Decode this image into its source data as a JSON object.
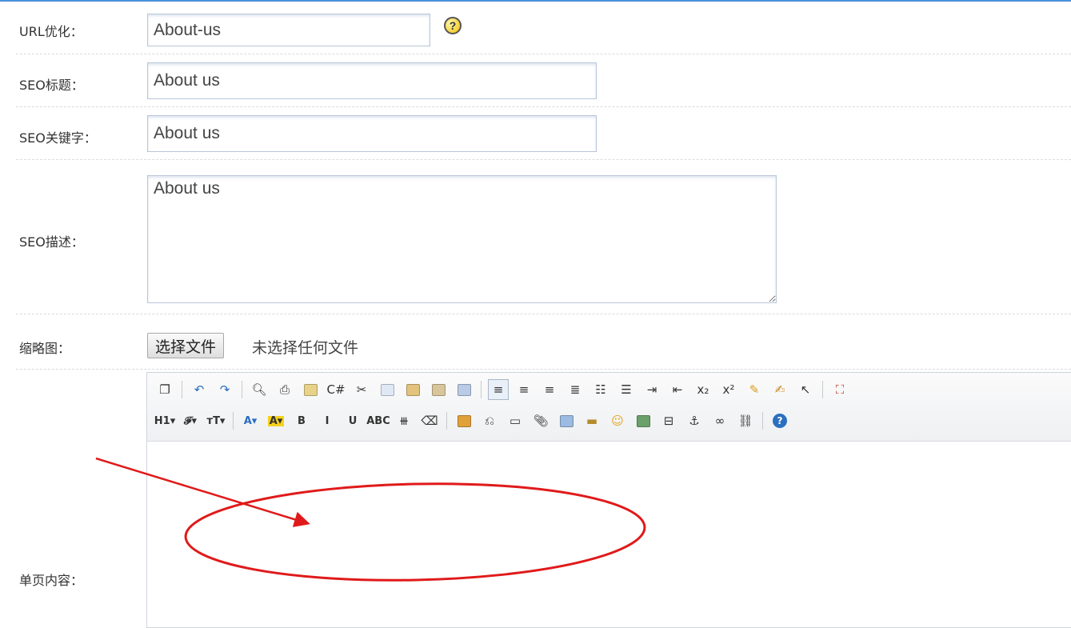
{
  "form": {
    "url": {
      "label": "URL优化：",
      "value": "About-us"
    },
    "seo_title": {
      "label": "SEO标题：",
      "value": "About us"
    },
    "seo_keywords": {
      "label": "SEO关键字：",
      "value": "About us"
    },
    "seo_desc": {
      "label": "SEO描述：",
      "value": "About us"
    },
    "thumbnail": {
      "label": "缩略图：",
      "button": "选择文件",
      "status": "未选择任何文件"
    },
    "content": {
      "label": "单页内容："
    }
  },
  "help": {
    "glyph": "?",
    "icon": "question-mark-icon"
  },
  "toolbar": {
    "row1": [
      {
        "name": "source-icon",
        "glyph": "❐"
      },
      {
        "sep": true
      },
      {
        "name": "undo-icon",
        "glyph": "↶",
        "color": "#2b6fc0"
      },
      {
        "name": "redo-icon",
        "glyph": "↷",
        "color": "#2b6fc0"
      },
      {
        "sep": true
      },
      {
        "name": "preview-icon",
        "glyph": "🔍︎"
      },
      {
        "name": "print-icon",
        "glyph": "⎙"
      },
      {
        "name": "template-icon",
        "box": "#e8d28a"
      },
      {
        "name": "code-icon",
        "glyph": "C#"
      },
      {
        "name": "cut-icon",
        "glyph": "✂"
      },
      {
        "name": "copy-icon",
        "box": "#dfe9f6"
      },
      {
        "name": "paste-icon",
        "box": "#e2c27c"
      },
      {
        "name": "paste-text-icon",
        "box": "#d8c69a"
      },
      {
        "name": "paste-word-icon",
        "box": "#b9cbe6"
      },
      {
        "sep": true
      },
      {
        "name": "align-left-icon",
        "glyph": "≡",
        "active": true
      },
      {
        "name": "align-center-icon",
        "glyph": "≡"
      },
      {
        "name": "align-right-icon",
        "glyph": "≡"
      },
      {
        "name": "justify-icon",
        "glyph": "≣"
      },
      {
        "name": "ordered-list-icon",
        "glyph": "☷"
      },
      {
        "name": "unordered-list-icon",
        "glyph": "☰"
      },
      {
        "name": "indent-icon",
        "glyph": "⇥"
      },
      {
        "name": "outdent-icon",
        "glyph": "⇤"
      },
      {
        "name": "subscript-icon",
        "glyph": "x₂"
      },
      {
        "name": "superscript-icon",
        "glyph": "x²"
      },
      {
        "name": "clear-format-icon",
        "glyph": "✎",
        "color": "#d89a1c"
      },
      {
        "name": "select-all-icon",
        "glyph": "✍",
        "color": "#c48a2a"
      },
      {
        "name": "cursor-icon",
        "glyph": "↖"
      },
      {
        "sep": true
      },
      {
        "name": "fullscreen-icon",
        "glyph": "⛶",
        "color": "#c0392b"
      }
    ],
    "row2": [
      {
        "name": "heading-icon",
        "text": "H1▾"
      },
      {
        "name": "font-family-icon",
        "text": "𝓕▾"
      },
      {
        "name": "font-size-icon",
        "text": "тT▾"
      },
      {
        "sep": true
      },
      {
        "name": "font-color-icon",
        "text": "A▾",
        "color": "#2b6fc0"
      },
      {
        "name": "highlight-color-icon",
        "text": "A▾",
        "color": "#333",
        "bg": "#f7d21c"
      },
      {
        "name": "bold-icon",
        "text": "B"
      },
      {
        "name": "italic-icon",
        "text": "I"
      },
      {
        "name": "underline-icon",
        "text": "U"
      },
      {
        "name": "strikethrough-icon",
        "text": "ABC"
      },
      {
        "name": "line-height-icon",
        "glyph": "⧻"
      },
      {
        "name": "eraser-icon",
        "glyph": "⌫"
      },
      {
        "sep": true
      },
      {
        "name": "image-icon",
        "box": "#e0a13a"
      },
      {
        "name": "flash-icon",
        "glyph": "⎌"
      },
      {
        "name": "media-icon",
        "glyph": "▭"
      },
      {
        "name": "attachment-icon",
        "glyph": "📎︎"
      },
      {
        "name": "table-icon",
        "box": "#9bbbe2"
      },
      {
        "name": "horizontal-rule-icon",
        "glyph": "▬",
        "color": "#b58a2a"
      },
      {
        "name": "emoticon-icon",
        "glyph": "☺",
        "color": "#e3a21a"
      },
      {
        "name": "map-icon",
        "box": "#6aa06a"
      },
      {
        "name": "page-break-icon",
        "glyph": "⊟"
      },
      {
        "name": "anchor-icon",
        "glyph": "⚓"
      },
      {
        "name": "link-icon",
        "glyph": "∞"
      },
      {
        "name": "unlink-icon",
        "glyph": "⛓"
      },
      {
        "sep": true
      },
      {
        "name": "about-help-icon",
        "glyph": "?",
        "round": true
      }
    ]
  },
  "annotation": {
    "arrow_color": "#e01a1a",
    "ellipse_color": "#e01a1a"
  }
}
